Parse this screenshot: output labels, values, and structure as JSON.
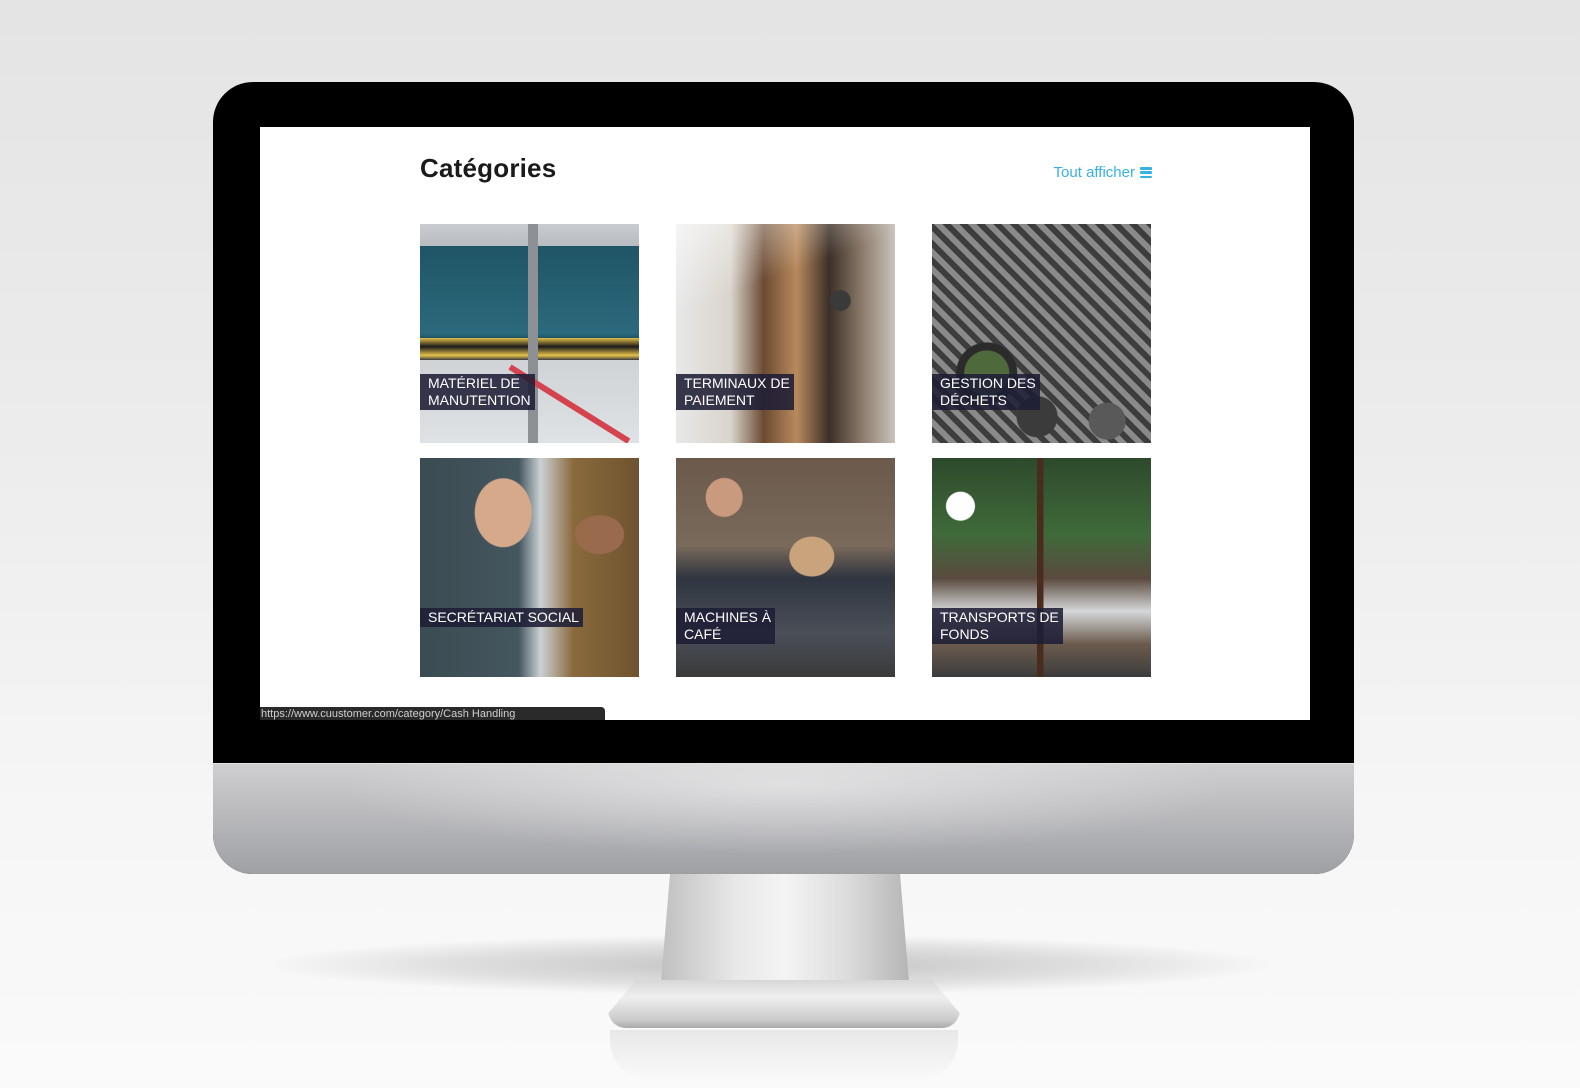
{
  "page": {
    "title": "Catégories",
    "view_all": {
      "label": "Tout afficher",
      "icon": "menu-icon"
    }
  },
  "categories": [
    {
      "label": "MATÉRIEL DE\nMANUTENTION",
      "photo": "warehouse loading docks"
    },
    {
      "label": "TERMINAUX DE\nPAIEMENT",
      "photo": "busy café counter"
    },
    {
      "label": "GESTION DES\nDÉCHETS",
      "photo": "waste bins aerial view"
    },
    {
      "label": "SECRÉTARIAT SOCIAL",
      "photo": "two men talking"
    },
    {
      "label": "MACHINES À\nCAFÉ",
      "photo": "people with coffee and pug"
    },
    {
      "label": "TRANSPORTS DE\nFONDS",
      "photo": "business meeting in café"
    }
  ],
  "status_bar": {
    "url": "https://www.cuustomer.com/category/Cash Handling"
  },
  "colors": {
    "accent": "#36b1e3",
    "label_bg": "#1e1e36",
    "title": "#1a1a1a"
  }
}
